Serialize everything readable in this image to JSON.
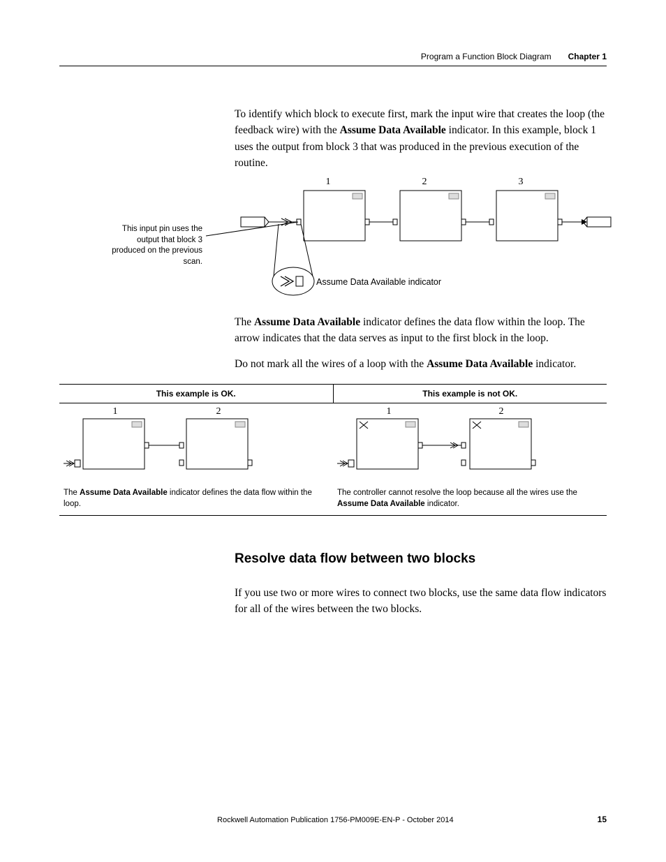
{
  "header": {
    "breadcrumb": "Program a Function Block Diagram",
    "chapter": "Chapter 1"
  },
  "para1": {
    "pre": "To identify which block to execute first, mark the input wire that creates the loop (the feedback wire) with the ",
    "bold1": "Assume Data Available",
    "post": " indicator. In this example, block 1 uses the output from block 3 that was produced in the previous execution of the routine."
  },
  "diagram1": {
    "callout": "This input pin uses the output that block 3 produced on the previous scan.",
    "numbers": {
      "n1": "1",
      "n2": "2",
      "n3": "3"
    },
    "ada_label": "Assume Data Available indicator"
  },
  "para2": {
    "pre": "The ",
    "bold1": "Assume Data Available",
    "post": " indicator defines the data flow within the loop. The arrow indicates that the data serves as input to the first block in the loop."
  },
  "para3": {
    "pre": "Do not mark all the wires of a loop with the ",
    "bold1": "Assume Data Available",
    "post": " indicator."
  },
  "table": {
    "left_header": "This example is OK.",
    "right_header": "This example is not OK.",
    "left_caption_pre": "The ",
    "left_caption_bold": "Assume Data Available",
    "left_caption_post": " indicator defines the data flow within the loop.",
    "right_caption_pre": "The controller cannot resolve the loop because all the wires use the ",
    "right_caption_bold": "Assume Data Available",
    "right_caption_post": " indicator.",
    "nums": {
      "n1": "1",
      "n2": "2"
    }
  },
  "section_head": "Resolve data flow between two blocks",
  "para4": "If you use two or more wires to connect two blocks, use the same data flow indicators for all of the wires between the two blocks.",
  "footer": {
    "publication": "Rockwell Automation Publication 1756-PM009E-EN-P - October 2014",
    "page": "15"
  }
}
